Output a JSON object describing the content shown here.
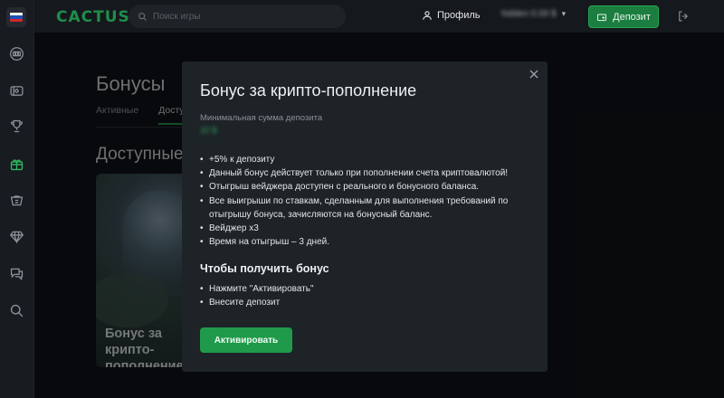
{
  "header": {
    "logo": "CACTUS",
    "search_placeholder": "Поиск игры",
    "profile_label": "Профиль",
    "balance_masked": "hidden 0.00 $",
    "deposit_label": "Депозит"
  },
  "sidebar": {
    "items": [
      "flag-ru",
      "slots-icon",
      "ticket-icon",
      "trophy-icon",
      "gift-icon",
      "casino-icon",
      "diamond-icon",
      "chat-icon",
      "search-icon"
    ],
    "active": "gift-icon"
  },
  "page": {
    "title": "Бонусы",
    "tabs": [
      {
        "label": "Активные",
        "active": false
      },
      {
        "label": "Доступные",
        "active": true
      }
    ],
    "section_title": "Доступные",
    "card_title": "Бонус за крипто-пополнение"
  },
  "modal": {
    "title": "Бонус за крипто-пополнение",
    "min_deposit_label": "Минимальная сумма депозита",
    "min_deposit_value": "10 $",
    "conditions": [
      "+5% к депозиту",
      "Данный бонус действует только при пополнении счета криптовалютой!",
      "Отыгрыш вейджера доступен с реального и бонусного баланса.",
      "Все выигрыши по ставкам, сделанным для выполнения требований по отыгрышу бонуса, зачисляются на бонусный баланс.",
      "Вейджер x3",
      "Время на отыгрыш – 3 дней."
    ],
    "how_to_title": "Чтобы получить бонус",
    "steps": [
      "Нажмите \"Активировать\"",
      "Внесите депозит"
    ],
    "activate_label": "Активировать"
  },
  "colors": {
    "accent": "#1f9a4a",
    "background": "#101216",
    "modal": "#1d2327"
  }
}
